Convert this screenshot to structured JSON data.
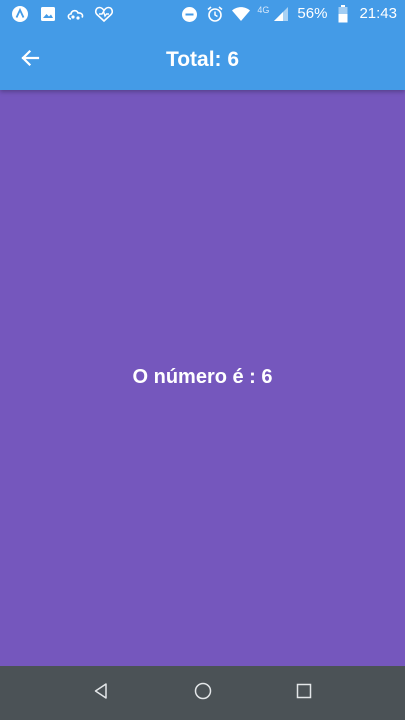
{
  "status_bar": {
    "left_icons": [
      "app-launcher-icon",
      "image-icon",
      "cloud-icon",
      "health-heart-icon"
    ],
    "right_icons": [
      "do-not-disturb-icon",
      "alarm-icon",
      "wifi-icon",
      "signal-icon",
      "battery-icon"
    ],
    "network": "4G",
    "battery": "56%",
    "time": "21:43"
  },
  "app_bar": {
    "back_icon": "arrow-back-icon",
    "title": "Total: 6"
  },
  "main": {
    "text": "O número é : 6"
  },
  "nav_bar": {
    "buttons": [
      "back-triangle-icon",
      "home-circle-icon",
      "recents-square-icon"
    ]
  },
  "colors": {
    "app_bar": "#449BE7",
    "background": "#7557BD",
    "nav_bar": "#4B5256",
    "text": "#FFFFFF"
  }
}
